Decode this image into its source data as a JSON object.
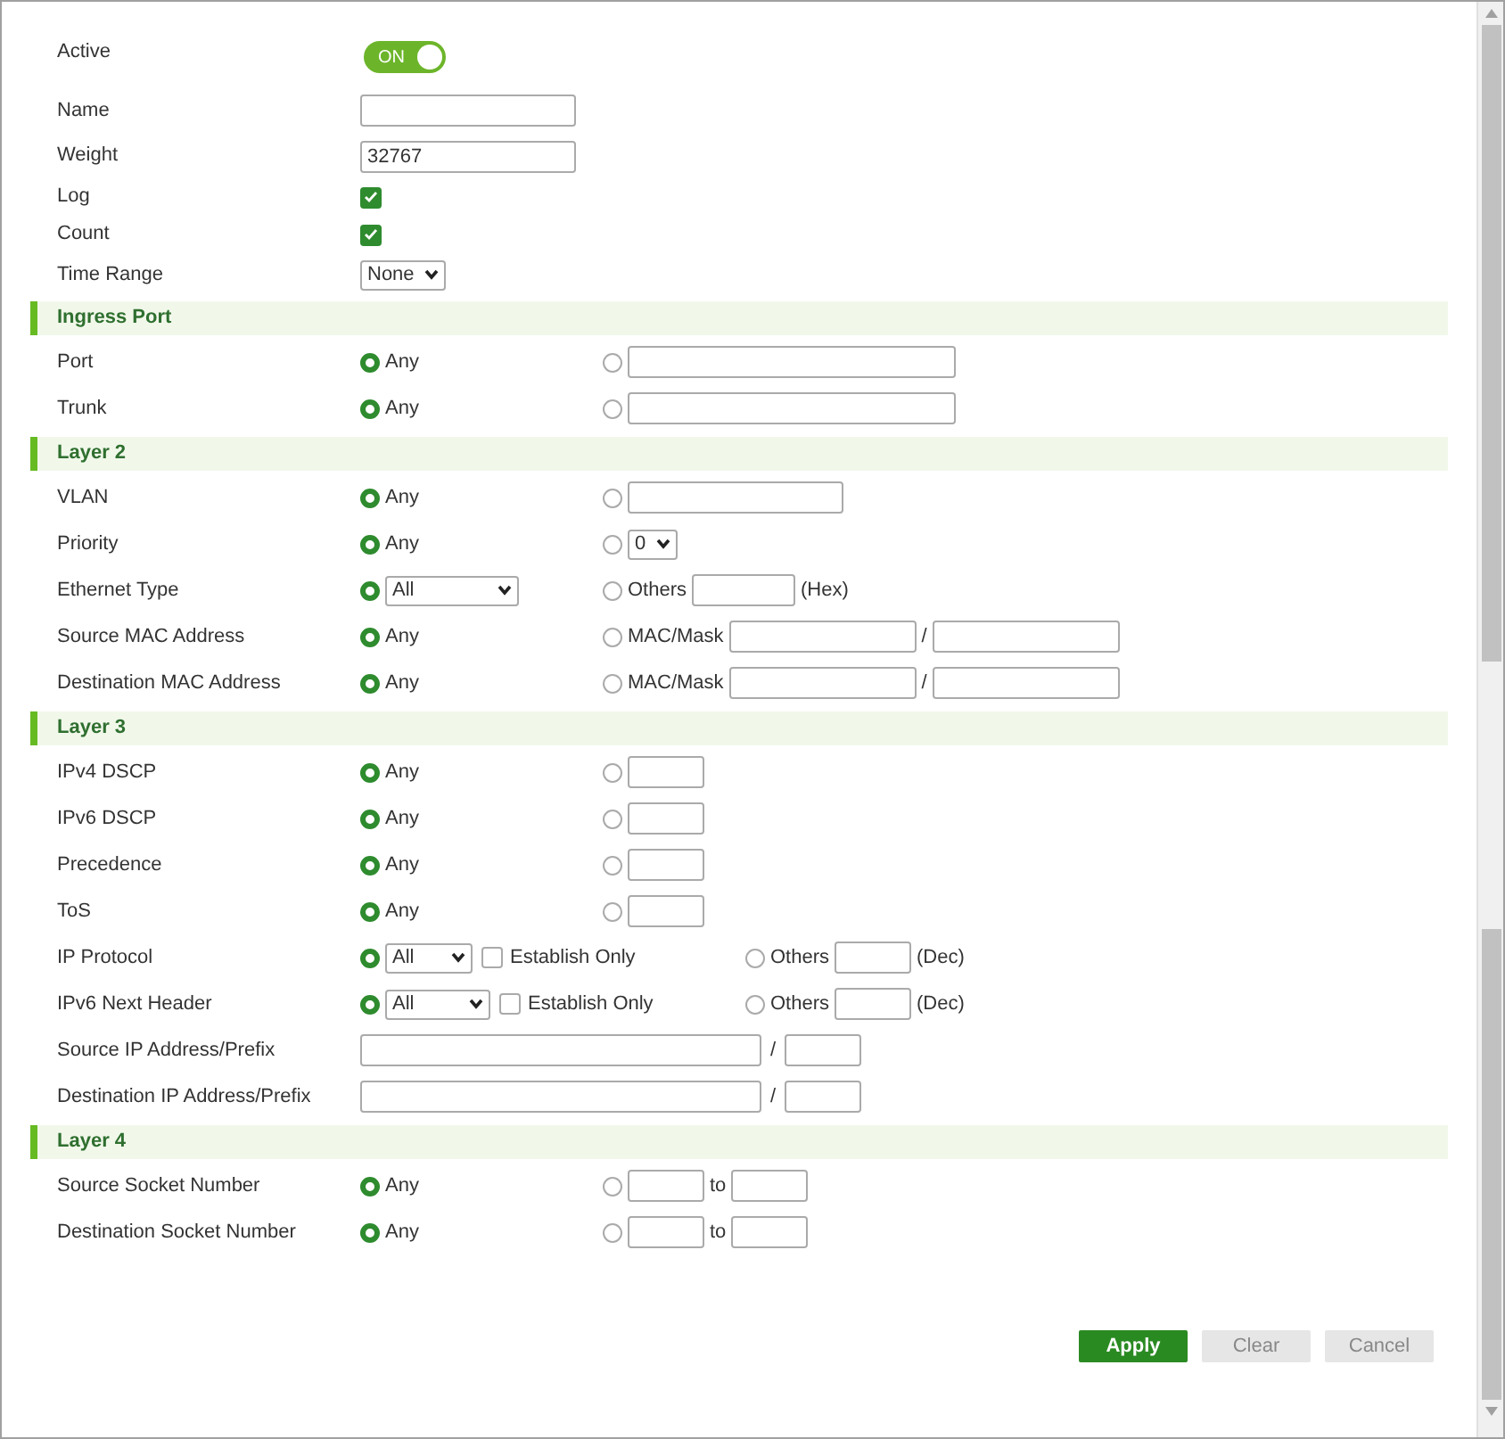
{
  "general": [
    {
      "kind": "toggle",
      "label": "Active",
      "on": true,
      "text": "ON"
    },
    {
      "kind": "field",
      "label": "Name"
    },
    {
      "kind": "field",
      "label": "Weight",
      "value": "32767"
    },
    {
      "kind": "checkbox",
      "label": "Log",
      "checked": true
    },
    {
      "kind": "checkbox",
      "label": "Count",
      "checked": true
    },
    {
      "kind": "select",
      "label": "Time Range",
      "value": "None"
    }
  ],
  "sections": [
    {
      "title": "Ingress Port",
      "rows": [
        {
          "kind": "radio",
          "label": "Port",
          "options": [
            {
              "selected": true,
              "parts": [
                {
                  "kind": "text",
                  "text": "Any"
                }
              ]
            },
            {
              "selected": false,
              "parts": [
                {
                  "kind": "longfield"
                }
              ]
            }
          ]
        },
        {
          "kind": "radio",
          "label": "Trunk",
          "options": [
            {
              "selected": true,
              "parts": [
                {
                  "kind": "text",
                  "text": "Any"
                }
              ]
            },
            {
              "selected": false,
              "parts": [
                {
                  "kind": "longfield"
                }
              ]
            }
          ]
        }
      ]
    },
    {
      "title": "Layer 2",
      "rows": [
        {
          "kind": "radio",
          "label": "VLAN",
          "options": [
            {
              "selected": true,
              "parts": [
                {
                  "kind": "text",
                  "text": "Any"
                }
              ]
            },
            {
              "selected": false,
              "parts": [
                {
                  "kind": "mediumfield"
                }
              ]
            }
          ]
        },
        {
          "kind": "radio",
          "label": "Priority",
          "options": [
            {
              "selected": true,
              "parts": [
                {
                  "kind": "text",
                  "text": "Any"
                }
              ]
            },
            {
              "selected": false,
              "parts": [
                {
                  "kind": "tinyselect",
                  "value": "0"
                }
              ]
            }
          ]
        },
        {
          "kind": "radio",
          "label": "Ethernet Type",
          "options": [
            {
              "selected": true,
              "parts": [
                {
                  "kind": "wideselect",
                  "value": "All"
                }
              ]
            },
            {
              "selected": false,
              "parts": [
                {
                  "kind": "text",
                  "text": "Others"
                },
                {
                  "kind": "smallfield"
                },
                {
                  "kind": "text",
                  "text": "(Hex)"
                }
              ]
            }
          ]
        },
        {
          "kind": "radio",
          "label": "Source MAC Address",
          "options": [
            {
              "selected": true,
              "parts": [
                {
                  "kind": "text",
                  "text": "Any"
                }
              ]
            },
            {
              "selected": false,
              "parts": [
                {
                  "kind": "text",
                  "text": "MAC/Mask"
                },
                {
                  "kind": "macfield"
                },
                {
                  "kind": "text",
                  "text": "/"
                },
                {
                  "kind": "macfield"
                }
              ]
            }
          ]
        },
        {
          "kind": "radio",
          "label": "Destination MAC Address",
          "options": [
            {
              "selected": true,
              "parts": [
                {
                  "kind": "text",
                  "text": "Any"
                }
              ]
            },
            {
              "selected": false,
              "parts": [
                {
                  "kind": "text",
                  "text": "MAC/Mask"
                },
                {
                  "kind": "macfield"
                },
                {
                  "kind": "text",
                  "text": "/"
                },
                {
                  "kind": "macfield"
                }
              ]
            }
          ]
        }
      ]
    },
    {
      "title": "Layer 3",
      "rows": [
        {
          "kind": "radio",
          "label": "IPv4 DSCP",
          "options": [
            {
              "selected": true,
              "parts": [
                {
                  "kind": "text",
                  "text": "Any"
                }
              ]
            },
            {
              "selected": false,
              "parts": [
                {
                  "kind": "tinyfield"
                }
              ]
            }
          ]
        },
        {
          "kind": "radio",
          "label": "IPv6 DSCP",
          "options": [
            {
              "selected": true,
              "parts": [
                {
                  "kind": "text",
                  "text": "Any"
                }
              ]
            },
            {
              "selected": false,
              "parts": [
                {
                  "kind": "tinyfield"
                }
              ]
            }
          ]
        },
        {
          "kind": "radio",
          "label": "Precedence",
          "options": [
            {
              "selected": true,
              "parts": [
                {
                  "kind": "text",
                  "text": "Any"
                }
              ]
            },
            {
              "selected": false,
              "parts": [
                {
                  "kind": "tinyfield"
                }
              ]
            }
          ]
        },
        {
          "kind": "radio",
          "label": "ToS",
          "options": [
            {
              "selected": true,
              "parts": [
                {
                  "kind": "text",
                  "text": "Any"
                }
              ]
            },
            {
              "selected": false,
              "parts": [
                {
                  "kind": "tinyfield"
                }
              ]
            }
          ]
        },
        {
          "kind": "protocol",
          "label": "IP Protocol",
          "options": [
            {
              "selected": true,
              "parts": [
                {
                  "kind": "select",
                  "value": "All"
                },
                {
                  "kind": "checkbox",
                  "checked": false,
                  "text": "Establish Only"
                }
              ]
            },
            {
              "selected": false,
              "parts": [
                {
                  "kind": "text",
                  "text": "Others"
                },
                {
                  "kind": "tinyfield"
                },
                {
                  "kind": "text",
                  "text": "(Dec)"
                }
              ]
            }
          ]
        },
        {
          "kind": "protocol",
          "label": "IPv6 Next Header",
          "options": [
            {
              "selected": true,
              "parts": [
                {
                  "kind": "midselect",
                  "value": "All"
                },
                {
                  "kind": "checkbox",
                  "checked": false,
                  "text": "Establish Only"
                }
              ]
            },
            {
              "selected": false,
              "parts": [
                {
                  "kind": "text",
                  "text": "Others"
                },
                {
                  "kind": "tinyfield"
                },
                {
                  "kind": "text",
                  "text": "(Dec)"
                }
              ]
            }
          ]
        },
        {
          "kind": "plain",
          "label": "Source IP Address/Prefix",
          "parts": [
            {
              "kind": "ipfield"
            },
            {
              "kind": "text",
              "text": "/"
            },
            {
              "kind": "tinyfield"
            }
          ]
        },
        {
          "kind": "plain",
          "label": "Destination IP Address/Prefix",
          "parts": [
            {
              "kind": "ipfield"
            },
            {
              "kind": "text",
              "text": "/"
            },
            {
              "kind": "tinyfield"
            }
          ]
        }
      ]
    },
    {
      "title": "Layer 4",
      "rows": [
        {
          "kind": "radio",
          "label": "Source Socket Number",
          "options": [
            {
              "selected": true,
              "parts": [
                {
                  "kind": "text",
                  "text": "Any"
                }
              ]
            },
            {
              "selected": false,
              "parts": [
                {
                  "kind": "tinyfield"
                },
                {
                  "kind": "text",
                  "text": "to"
                },
                {
                  "kind": "tinyfield"
                }
              ]
            }
          ]
        },
        {
          "kind": "radio",
          "label": "Destination Socket Number",
          "options": [
            {
              "selected": true,
              "parts": [
                {
                  "kind": "text",
                  "text": "Any"
                }
              ]
            },
            {
              "selected": false,
              "parts": [
                {
                  "kind": "tinyfield"
                },
                {
                  "kind": "text",
                  "text": "to"
                },
                {
                  "kind": "tinyfield"
                }
              ]
            }
          ]
        }
      ]
    }
  ],
  "buttons": [
    {
      "kind": "primary",
      "label": "Apply"
    },
    {
      "kind": "secondary",
      "label": "Clear"
    },
    {
      "kind": "secondary",
      "label": "Cancel"
    }
  ]
}
